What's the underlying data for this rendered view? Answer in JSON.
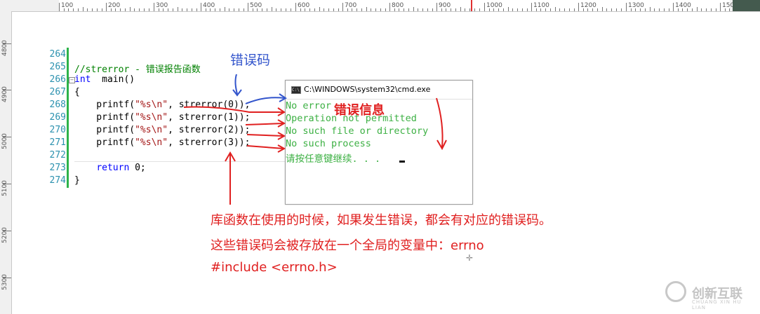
{
  "ruler": {
    "top_labels": [
      "100",
      "200",
      "300",
      "400",
      "500",
      "600",
      "700",
      "800",
      "900",
      "1000",
      "1100",
      "1200",
      "1300",
      "1400",
      "1500"
    ],
    "left_labels": [
      "4800",
      "4900",
      "5000",
      "5100",
      "5200",
      "5300"
    ]
  },
  "code": {
    "lines": [
      {
        "num": "264",
        "text": ""
      },
      {
        "num": "265",
        "text": "//strerror - 错误报告函数"
      },
      {
        "num": "266",
        "keyword": "int",
        "text": "  main()"
      },
      {
        "num": "267",
        "text": "{"
      },
      {
        "num": "268",
        "fn": "    printf(",
        "str": "\"%s\\n\"",
        "rest": ", strerror(0));"
      },
      {
        "num": "269",
        "fn": "    printf(",
        "str": "\"%s\\n\"",
        "rest": ", strerror(1));"
      },
      {
        "num": "270",
        "fn": "    printf(",
        "str": "\"%s\\n\"",
        "rest": ", strerror(2));"
      },
      {
        "num": "271",
        "fn": "    printf(",
        "str": "\"%s\\n\"",
        "rest": ", strerror(3));"
      },
      {
        "num": "272",
        "text": ""
      },
      {
        "num": "273",
        "keyword": "return",
        "text": " 0;",
        "indent": "    "
      },
      {
        "num": "274",
        "text": "}"
      }
    ],
    "collapse_symbol": "−"
  },
  "console": {
    "title": "C:\\WINDOWS\\system32\\cmd.exe",
    "icon_text": "C:\\",
    "output": [
      "No error",
      "Operation not permitted",
      "No such file or directory",
      "No such process",
      "请按任意键继续. . ."
    ]
  },
  "annotations": {
    "error_code_label": "错误码",
    "error_info_label": "错误信息",
    "paragraph": [
      "库函数在使用的时候，如果发生错误，都会有对应的错误码。",
      "这些错误码会被存放在一个全局的变量中：errno",
      "#include <errno.h>"
    ]
  },
  "watermark": {
    "name": "创新互联",
    "sub": "CHUANG XIN HU LIAN"
  },
  "colors": {
    "comment": "#008000",
    "keyword": "#0000ff",
    "string": "#a31515",
    "line_number": "#2b91af",
    "console_text": "#3cb043",
    "annotation_red": "#e02020",
    "annotation_blue": "#3355cc"
  }
}
